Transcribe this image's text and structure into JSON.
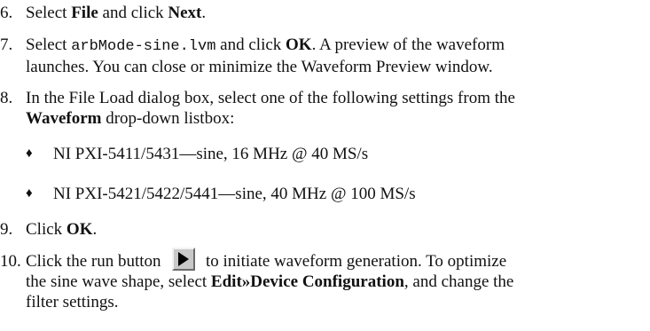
{
  "steps": [
    {
      "num": "6.",
      "a": "Select ",
      "b1": "File",
      "c": " and click ",
      "b2": "Next",
      "d": "."
    },
    {
      "num": "7.",
      "a": "Select ",
      "code": "arbMode-sine.lvm",
      "c": " and click ",
      "b2": "OK",
      "d": ". A preview of the waveform",
      "line2": "launches. You can close or minimize the Waveform Preview window."
    },
    {
      "num": "8.",
      "line1": "In the File Load dialog box, select one of the following settings from the",
      "b1": "Waveform",
      "rest": " drop-down listbox:"
    },
    {
      "num": "9.",
      "a": "Click ",
      "b1": "OK",
      "d": "."
    },
    {
      "num": "10.",
      "a": "Click the run button",
      "d": "to initiate waveform generation. To optimize",
      "line2a": "the sine wave shape, select ",
      "line2b": "Edit»Device Configuration",
      "line2c": ", and change the",
      "line3": "filter settings."
    }
  ],
  "bullets": [
    {
      "symbol": "♦",
      "text": "NI PXI-5411/5431—sine, 16 MHz @ 40 MS/s"
    },
    {
      "symbol": "♦",
      "text": "NI PXI-5421/5422/5441—sine, 40 MHz @ 100 MS/s"
    }
  ],
  "icons": {
    "run": "run-arrow-icon"
  }
}
